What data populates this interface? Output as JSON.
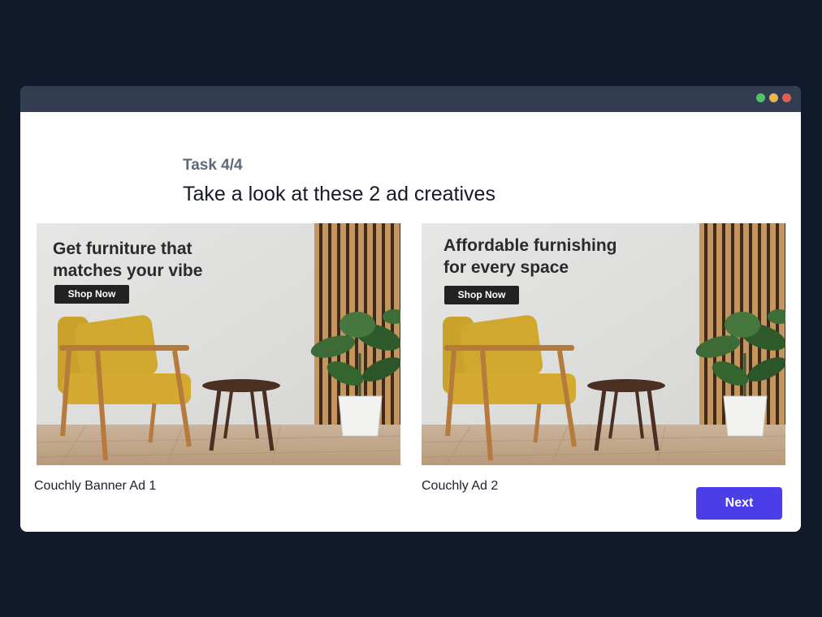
{
  "window": {
    "controls": [
      {
        "name": "green",
        "color": "#4fc56a"
      },
      {
        "name": "yellow",
        "color": "#e9b84a"
      },
      {
        "name": "red",
        "color": "#e0614f"
      }
    ]
  },
  "task": {
    "label": "Task 4/4",
    "heading": "Take a look at these 2 ad creatives"
  },
  "ads": [
    {
      "headline": "Get furniture that\nmatches your vibe",
      "cta": "Shop Now",
      "caption": "Couchly Banner Ad 1"
    },
    {
      "headline": "Affordable furnishing\nfor every space",
      "cta": "Shop Now",
      "caption": "Couchly Ad 2"
    }
  ],
  "actions": {
    "next_label": "Next",
    "accent_color": "#4b3ee6"
  }
}
